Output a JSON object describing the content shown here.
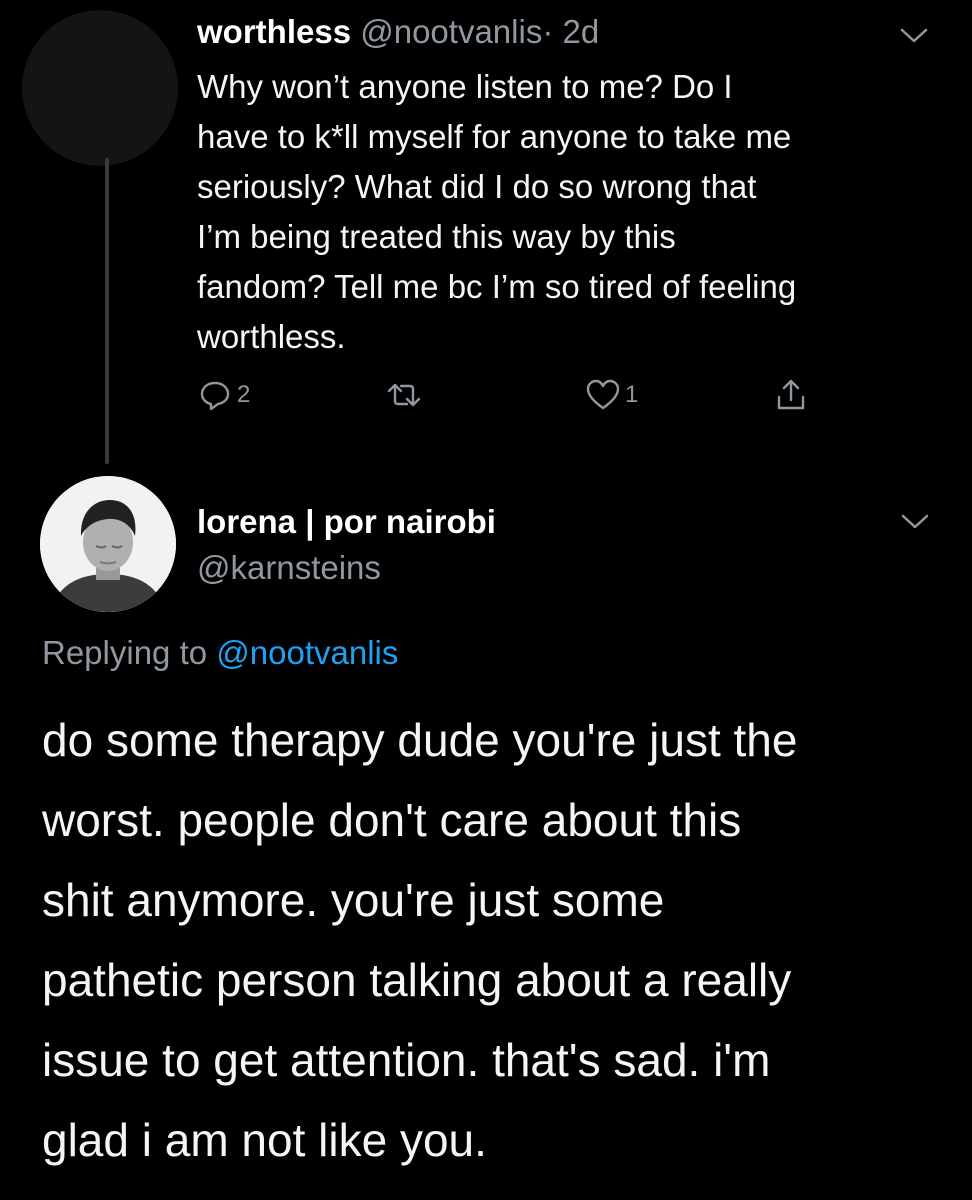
{
  "tweet1": {
    "display_name": "worthless",
    "handle": "@nootvanlis",
    "separator": "·",
    "time": "2d",
    "text_lines": [
      "Why won’t anyone listen to me?  Do I",
      "have to k*ll myself for anyone to take me",
      "seriously?  What did I do so wrong that",
      "I’m being treated this way by this",
      "fandom? Tell me bc I’m so tired of feeling",
      "worthless."
    ],
    "reply_count": "2",
    "like_count": "1",
    "icons": {
      "reply": "reply-icon",
      "retweet": "retweet-icon",
      "like": "heart-icon",
      "share": "share-icon",
      "menu": "chevron-down-icon"
    }
  },
  "tweet2": {
    "display_name": "lorena | por nairobi",
    "handle": "@karnsteins",
    "replying_prefix": "Replying to",
    "replying_handle": "@nootvanlis",
    "text_lines": [
      "do some therapy dude you're just the",
      "worst. people don't care about this",
      "shit anymore. you're just some",
      "pathetic person talking about a really",
      "issue to get attention. that's sad. i'm",
      "glad i am not like you."
    ]
  },
  "colors": {
    "background": "#000000",
    "primary_text": "#ffffff",
    "secondary_text": "#8f98a0",
    "link": "#1da1f2",
    "thread_line": "#3a3a3a"
  }
}
